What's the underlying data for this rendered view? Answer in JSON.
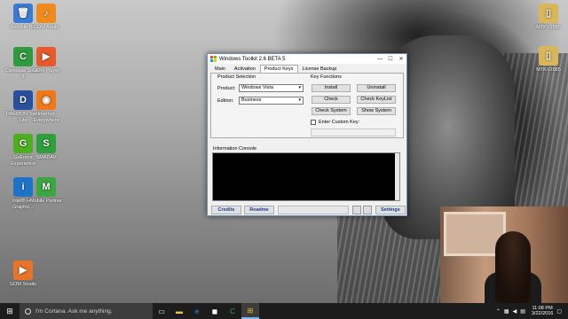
{
  "desktop": {
    "icons_left": [
      {
        "label": "Recycle Bin",
        "glyph": "🗑",
        "color": "#3b7bd4"
      },
      {
        "label": "Camtasia Studio 8",
        "glyph": "C",
        "color": "#2f9a3e"
      },
      {
        "label": "DAEMON Tools Lite",
        "glyph": "D",
        "color": "#2a4f9e"
      },
      {
        "label": "GeForce Experience",
        "glyph": "G",
        "color": "#4caf1e"
      },
      {
        "label": "Intel® HD Graphic...",
        "glyph": "i",
        "color": "#1e73c8"
      },
      {
        "label": "GOM Studio",
        "glyph": "▶",
        "color": "#e8742a"
      }
    ],
    "icons_col2": [
      {
        "label": "GOM Audio",
        "glyph": "♪",
        "color": "#f08a1c"
      },
      {
        "label": "GOM Player",
        "glyph": "▶",
        "color": "#e8582a"
      },
      {
        "label": "Internet Everywhere",
        "glyph": "◉",
        "color": "#f07818"
      },
      {
        "label": "SMADAV",
        "glyph": "S",
        "color": "#2e9f3a"
      },
      {
        "label": "Mobile Partner",
        "glyph": "M",
        "color": "#3ca640"
      }
    ],
    "icons_right": [
      {
        "label": "MTKV2685",
        "glyph": "▯",
        "color": "#d9b65a"
      },
      {
        "label": "MTKV2685",
        "glyph": "▯",
        "color": "#d9b65a"
      }
    ]
  },
  "window": {
    "title": "Windows Toolkit 2.6 BETA 5",
    "controls": {
      "minimize": "—",
      "maximize": "☐",
      "close": "✕"
    },
    "tabs": [
      {
        "label": "Main",
        "active": false
      },
      {
        "label": "Activation",
        "active": false
      },
      {
        "label": "Product Keys",
        "active": true
      },
      {
        "label": "License Backup",
        "active": false
      }
    ],
    "product_selection": {
      "title": "Product Selection",
      "product_label": "Product:",
      "product_value": "Windows Vista",
      "edition_label": "Edition:",
      "edition_value": "Business"
    },
    "key_functions": {
      "title": "Key Functions",
      "buttons": [
        "Install",
        "Uninstall",
        "Check",
        "Check KeyList",
        "Check System",
        "Show System"
      ],
      "custom_key_label": "Enter Custom Key:",
      "custom_key_value": ""
    },
    "info_console_label": "Information Console",
    "bottom": {
      "credits": "Credits",
      "readme": "Readme",
      "settings": "Settings"
    }
  },
  "taskbar": {
    "start_glyph": "⊞",
    "search_placeholder": "I'm Cortana. Ask me anything.",
    "apps": [
      "task-view",
      "file-explorer",
      "edge",
      "store",
      "camtasia",
      "toolkit"
    ],
    "clock_time": "11:08 PM",
    "clock_date": "3/22/2016"
  }
}
